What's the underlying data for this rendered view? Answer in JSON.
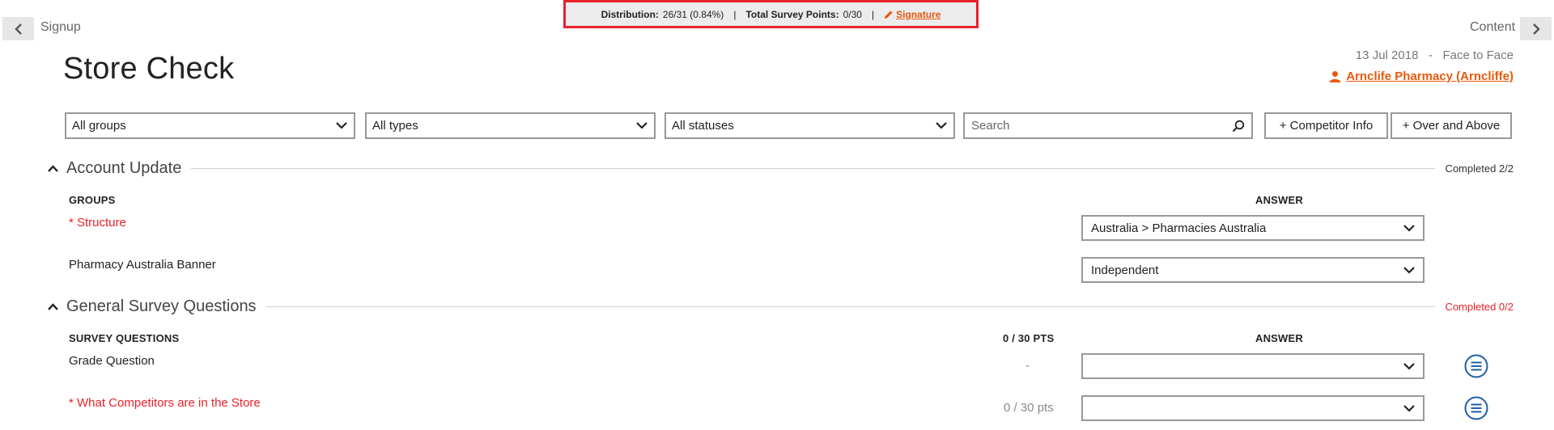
{
  "nav": {
    "back_label": "Signup",
    "forward_label": "Content"
  },
  "summary": {
    "distribution_label": "Distribution:",
    "distribution_value": "26/31 (0.84%)",
    "separator": "|",
    "points_label": "Total Survey Points:",
    "points_value": "0/30",
    "signature_label": "Signature"
  },
  "header": {
    "title": "Store Check",
    "date": "13 Jul 2018",
    "meta_separator": "-",
    "visit_type": "Face to Face",
    "store_name": "Arnclife Pharmacy (Arncliffe)"
  },
  "filters": {
    "groups": "All groups",
    "types": "All types",
    "statuses": "All statuses",
    "search_placeholder": "Search",
    "competitor_button": "+ Competitor Info",
    "over_above_button": "+ Over and Above"
  },
  "sections": [
    {
      "title": "Account Update",
      "status": "Completed 2/2",
      "col_left": "GROUPS",
      "col_answer": "ANSWER",
      "rows": [
        {
          "label": "* Structure",
          "answer": "Australia > Pharmacies Australia"
        },
        {
          "label": "Pharmacy Australia Banner",
          "answer": "Independent"
        }
      ]
    },
    {
      "title": "General Survey Questions",
      "status": "Completed 0/2",
      "col_left": "SURVEY QUESTIONS",
      "col_pts": "0 / 30 PTS",
      "col_answer": "ANSWER",
      "rows": [
        {
          "label": "Grade Question",
          "points": "-",
          "answer": ""
        },
        {
          "label": "* What Competitors are in the Store",
          "points": "0 / 30 pts",
          "answer": ""
        }
      ]
    }
  ],
  "colors": {
    "accent_orange": "#e8590c",
    "required_red": "#e8212a",
    "highlight_border": "#e8212a",
    "icon_blue": "#1f5fa8"
  },
  "icons": {
    "back": "chevron-left-icon",
    "forward": "chevron-right-icon",
    "signature": "pencil-icon",
    "store": "person-icon",
    "dropdown": "chevron-down-icon",
    "search": "search-icon",
    "collapse": "chevron-up-icon",
    "comments": "list-circle-icon"
  }
}
